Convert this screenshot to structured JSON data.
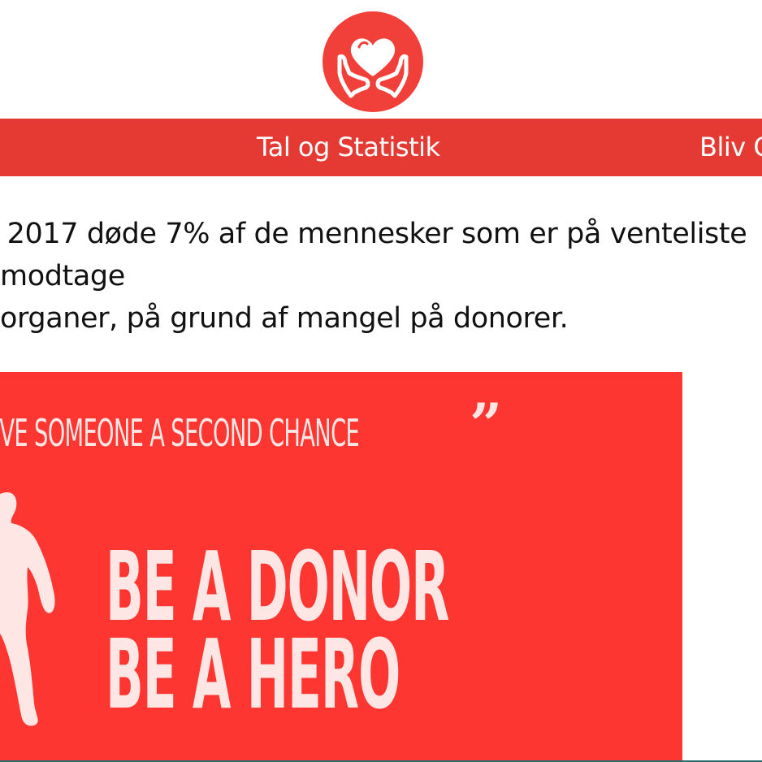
{
  "logo": {
    "icon": "heart-hands-icon",
    "color": "#f1403a"
  },
  "nav": {
    "items": [
      {
        "label": "Tal og Statistik"
      },
      {
        "label": "Bliv C"
      }
    ],
    "background": "#e43a33"
  },
  "intro": {
    "lines": [
      "I 2017 døde 7% af de mennesker som er på venteliste",
      "modtage",
      "organer, på grund af mangel på donorer."
    ]
  },
  "banner": {
    "background": "#fd3631",
    "tagline": "IVE SOMEONE A SECOND CHANCE",
    "headline_line1": "BE A DONOR",
    "headline_line2": "BE A HERO"
  }
}
